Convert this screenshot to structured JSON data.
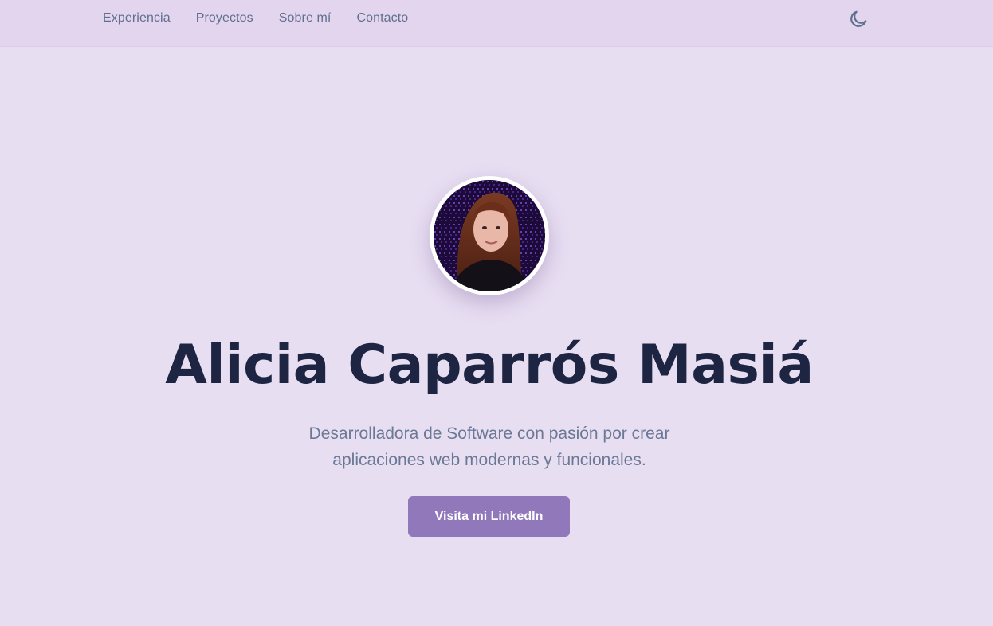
{
  "nav": {
    "items": [
      {
        "label": "Experiencia"
      },
      {
        "label": "Proyectos"
      },
      {
        "label": "Sobre mí"
      },
      {
        "label": "Contacto"
      }
    ],
    "theme_toggle_icon": "moon-icon"
  },
  "hero": {
    "avatar_icon": "profile-photo",
    "name": "Alicia Caparrós Masiá",
    "tagline_line1": "Desarrolladora de Software con pasión por crear",
    "tagline_line2": "aplicaciones web modernas y funcionales.",
    "cta_label": "Visita mi LinkedIn"
  },
  "colors": {
    "page_bg": "#e8def2",
    "navbar_bg": "#e3d5ee",
    "nav_text": "#5f6f8f",
    "heading": "#1d2542",
    "tagline": "#6b7896",
    "button_bg": "#9178bb",
    "button_text": "#ffffff"
  }
}
